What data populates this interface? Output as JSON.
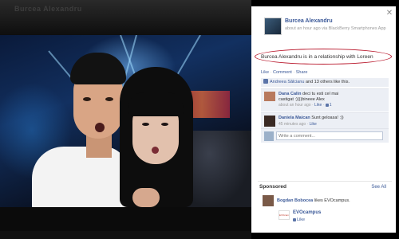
{
  "viewer": {
    "title": "Burcea Alexandru",
    "caption": ""
  },
  "post": {
    "author": "Burcea Alexandru",
    "meta": "about an hour ago via BlackBerry Smartphones App",
    "text": "Burcea Alexandru is in a relationship with Loreen",
    "highlight_color": "#b8162a"
  },
  "actions": {
    "like": "Like",
    "comment": "Comment",
    "share": "Share",
    "sep": "·"
  },
  "likes": {
    "names": "Andreea Sălcianu",
    "rest": " and 13 others like this."
  },
  "comments": [
    {
      "author": "Dana Calin",
      "text": "deci tu esti cel mai",
      "line2": "castigat :))))bineee Alex",
      "time": "about an hour ago",
      "like": "Like",
      "likes_count": "1"
    },
    {
      "author": "Daniela Maican",
      "text": "Sunt geloasa! :))",
      "time": "45 minutes ago",
      "like": "Like"
    }
  ],
  "comment_box": {
    "placeholder": "Write a comment..."
  },
  "sponsored": {
    "title": "Sponsored",
    "see_all": "See All",
    "ad1_user": "Bogdan Bobocea",
    "ad1_action": " likes EVOcampus.",
    "ad2_logo": "EVOcampus",
    "ad2_page": "EVOcampus",
    "ad2_like": "Like"
  },
  "colors": {
    "facebook_blue": "#3b5998",
    "panel_gray": "#eceff5"
  },
  "icons": {
    "close": "close-icon",
    "like": "thumbs-up-icon"
  }
}
